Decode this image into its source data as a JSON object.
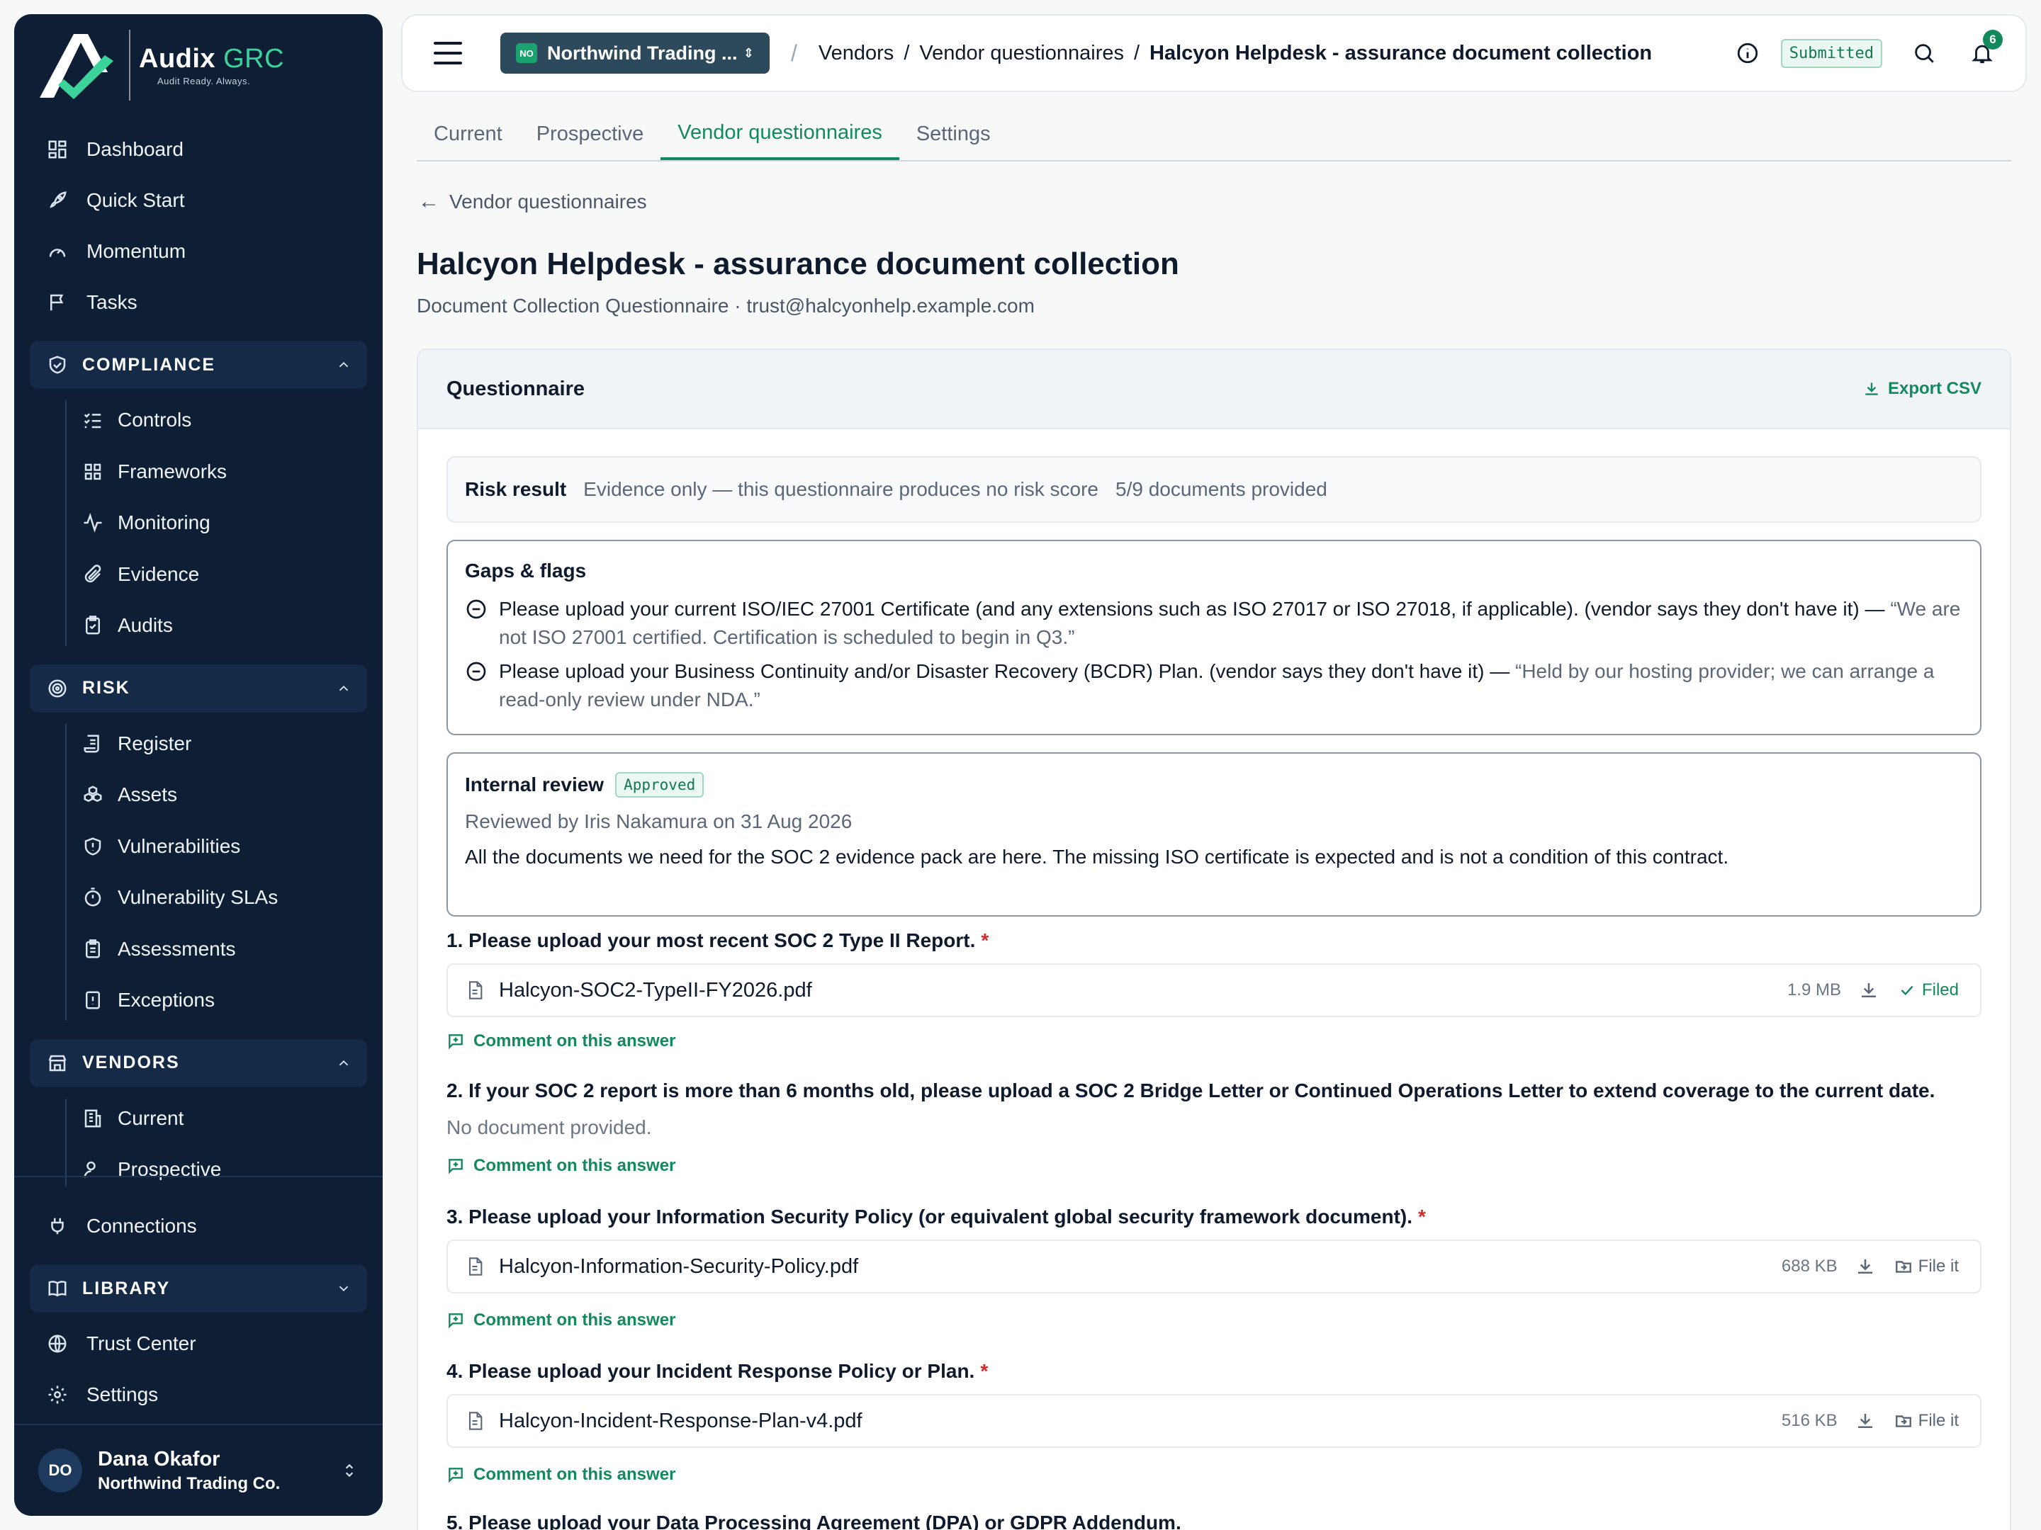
{
  "brand": {
    "name": "Audix",
    "name_accent": "GRC",
    "tagline": "Audit Ready. Always."
  },
  "sidebar": {
    "top_items": [
      {
        "label": "Dashboard",
        "icon": "grid-icon"
      },
      {
        "label": "Quick Start",
        "icon": "rocket-icon"
      },
      {
        "label": "Momentum",
        "icon": "gauge-icon"
      },
      {
        "label": "Tasks",
        "icon": "flag-icon"
      }
    ],
    "compliance": {
      "label": "COMPLIANCE",
      "items": [
        {
          "label": "Controls",
          "icon": "list-check-icon"
        },
        {
          "label": "Frameworks",
          "icon": "grid-icon"
        },
        {
          "label": "Monitoring",
          "icon": "activity-icon"
        },
        {
          "label": "Evidence",
          "icon": "paperclip-icon"
        },
        {
          "label": "Audits",
          "icon": "clipboard-check-icon"
        }
      ]
    },
    "risk": {
      "label": "RISK",
      "items": [
        {
          "label": "Register",
          "icon": "scroll-icon"
        },
        {
          "label": "Assets",
          "icon": "boxes-icon"
        },
        {
          "label": "Vulnerabilities",
          "icon": "shield-alert-icon"
        },
        {
          "label": "Vulnerability SLAs",
          "icon": "timer-icon"
        },
        {
          "label": "Assessments",
          "icon": "clipboard-list-icon"
        },
        {
          "label": "Exceptions",
          "icon": "alert-file-icon"
        }
      ]
    },
    "vendors": {
      "label": "VENDORS",
      "items": [
        {
          "label": "Current",
          "icon": "building-icon"
        },
        {
          "label": "Prospective",
          "icon": "user-search-icon"
        }
      ]
    },
    "connections": {
      "label": "Connections",
      "icon": "plug-icon"
    },
    "library": {
      "label": "LIBRARY"
    },
    "trust_center": {
      "label": "Trust Center",
      "icon": "globe-icon"
    },
    "settings": {
      "label": "Settings",
      "icon": "gear-icon"
    },
    "user": {
      "initials": "DO",
      "name": "Dana Okafor",
      "org": "Northwind Trading Co."
    }
  },
  "topbar": {
    "org_badge": "NO",
    "org_name": "Northwind Trading ...",
    "breadcrumbs": [
      "Vendors",
      "Vendor questionnaires",
      "Halcyon Helpdesk - assurance document collection"
    ],
    "status": "Submitted",
    "notification_count": "6"
  },
  "tabs": [
    "Current",
    "Prospective",
    "Vendor questionnaires",
    "Settings"
  ],
  "active_tab": "Vendor questionnaires",
  "back_label": "Vendor questionnaires",
  "page": {
    "title": "Halcyon Helpdesk - assurance document collection",
    "subtitle": "Document Collection Questionnaire · trust@halcyonhelp.example.com"
  },
  "questionnaire": {
    "title": "Questionnaire",
    "export_label": "Export CSV",
    "risk": {
      "label": "Risk result",
      "value": "Evidence only — this questionnaire produces no risk score",
      "count": "5/9 documents provided"
    },
    "gaps": {
      "title": "Gaps & flags",
      "items": [
        {
          "text": "Please upload your current ISO/IEC 27001 Certificate (and any extensions such as ISO 27017 or ISO 27018, if applicable). (vendor says they don't have it) —",
          "quote": "“We are not ISO 27001 certified. Certification is scheduled to begin in Q3.”"
        },
        {
          "text": "Please upload your Business Continuity and/or Disaster Recovery (BCDR) Plan. (vendor says they don't have it) —",
          "quote": "“Held by our hosting provider; we can arrange a read-only review under NDA.”"
        }
      ]
    },
    "review": {
      "title": "Internal review",
      "status": "Approved",
      "reviewed_by": "Reviewed by Iris Nakamura on 31 Aug 2026",
      "note": "All the documents we need for the SOC 2 evidence pack are here. The missing ISO certificate is expected and is not a condition of this contract."
    },
    "questions": [
      {
        "text": "1. Please upload your most recent SOC 2 Type II Report.",
        "required": "*",
        "file": "Halcyon-SOC2-TypeII-FY2026.pdf",
        "size": "1.9 MB",
        "action": "Filed"
      },
      {
        "text": "2. If your SOC 2 report is more than 6 months old, please upload a SOC 2 Bridge Letter or Continued Operations Letter to extend coverage to the current date.",
        "no_document": "No document provided."
      },
      {
        "text": "3. Please upload your Information Security Policy (or equivalent global security framework document).",
        "required": "*",
        "file": "Halcyon-Information-Security-Policy.pdf",
        "size": "688 KB",
        "action": "File it"
      },
      {
        "text": "4. Please upload your Incident Response Policy or Plan.",
        "required": "*",
        "file": "Halcyon-Incident-Response-Plan-v4.pdf",
        "size": "516 KB",
        "action": "File it"
      },
      {
        "text": "5. Please upload your Data Processing Agreement (DPA) or GDPR Addendum."
      }
    ],
    "comment_label": "Comment on this answer"
  },
  "colors": {
    "sidebar_bg": "#0d1e35",
    "accent": "#15895e",
    "required": "#d12c2c"
  }
}
